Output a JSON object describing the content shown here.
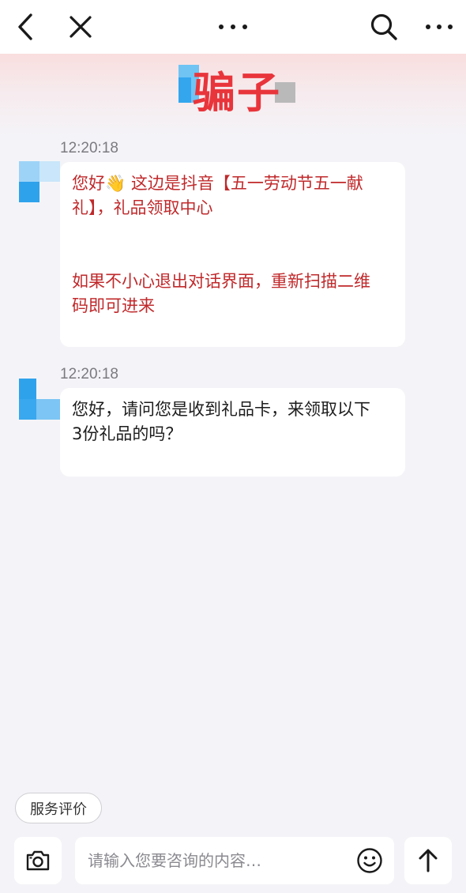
{
  "topbar": {
    "back_icon": "chevron-left-icon",
    "close_icon": "close-icon",
    "center_more_icon": "ellipsis-icon",
    "search_icon": "search-icon",
    "right_more_icon": "ellipsis-icon"
  },
  "header": {
    "contact_name": "骗子",
    "name_color": "#e8353b"
  },
  "messages": [
    {
      "time": "12:20:18",
      "lines": [
        "您好👋 这边是抖音【五一劳动节五一献",
        "礼】，礼品领取中心"
      ],
      "lines2": [
        "如果不小心退出对话界面，重新扫描二维",
        "码即可进来"
      ],
      "text_color": "#c0292b"
    },
    {
      "time": "12:20:18",
      "lines": [
        "您好，请问您是收到礼品卡，来领取以下",
        "3份礼品的吗？"
      ],
      "text_color": "#1c1c1c"
    }
  ],
  "rating_button": {
    "label": "服务评价"
  },
  "input": {
    "placeholder": "请输入您要咨询的内容…"
  },
  "icons": {
    "camera": "camera-icon",
    "emoji": "smiley-icon",
    "send": "arrow-up-icon"
  }
}
